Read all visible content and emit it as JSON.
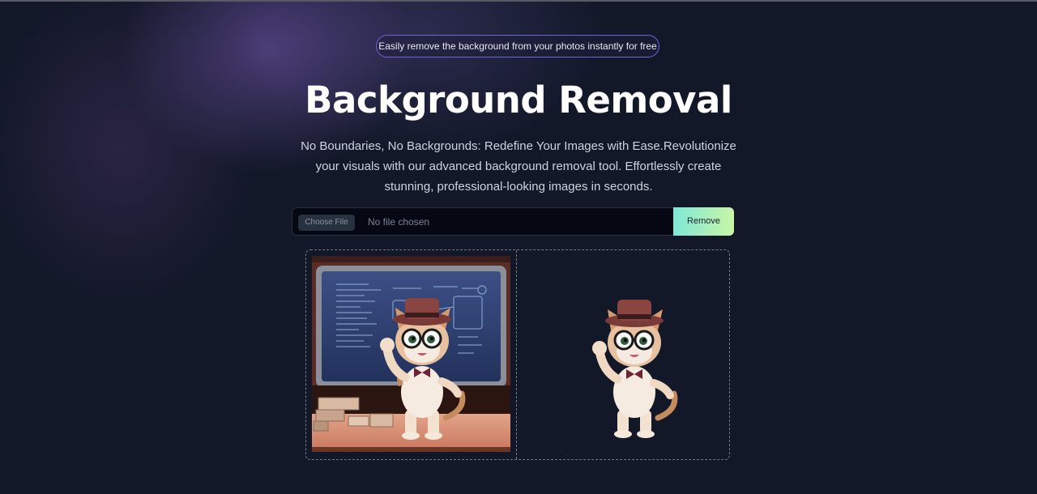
{
  "hero": {
    "tagline": "Easily remove the background from your photos instantly for free",
    "title": "Background Removal",
    "description": "No Boundaries, No Backgrounds: Redefine Your Images with Ease.Revolutionize your visuals with our advanced background removal tool. Effortlessly create stunning, professional-looking images in seconds."
  },
  "upload": {
    "choose_file_label": "Choose File",
    "file_status": "No file chosen",
    "remove_label": "Remove"
  },
  "preview": {
    "original_image": "cat-teacher-with-chalkboard",
    "processed_image": "cat-teacher-background-removed"
  },
  "colors": {
    "background": "#131829",
    "accent_gradient_start": "#7fe8d8",
    "accent_gradient_end": "#c9f5a6",
    "pill_border": "#6c66d8"
  }
}
